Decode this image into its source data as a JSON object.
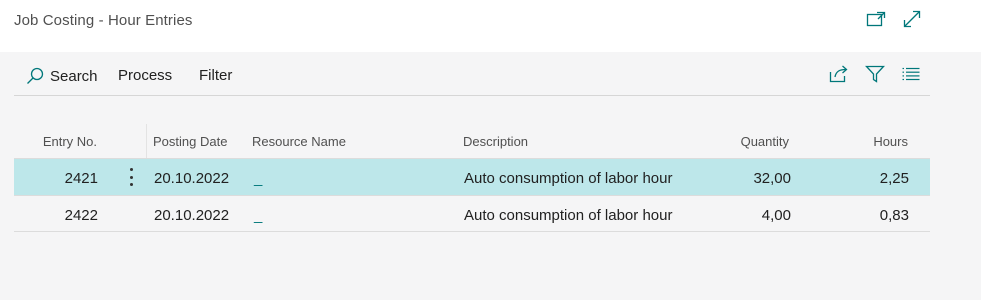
{
  "page": {
    "title": "Job Costing - Hour Entries"
  },
  "toolbar": {
    "search_label": "Search",
    "process_label": "Process",
    "filter_label": "Filter"
  },
  "columns": {
    "entry_no": "Entry No.",
    "posting_date": "Posting Date",
    "resource_name": "Resource Name",
    "description": "Description",
    "quantity": "Quantity",
    "hours": "Hours"
  },
  "rows": [
    {
      "entry_no": "2421",
      "posting_date": "20.10.2022",
      "resource_name": "_",
      "description": "Auto consumption of labor hour",
      "quantity": "32,00",
      "hours": "2,25",
      "selected": true
    },
    {
      "entry_no": "2422",
      "posting_date": "20.10.2022",
      "resource_name": "_",
      "description": "Auto consumption of labor hour",
      "quantity": "4,00",
      "hours": "0,83",
      "selected": false
    }
  ],
  "icons": {
    "popout": "popout-icon",
    "expand": "expand-icon",
    "search": "search-icon",
    "share": "share-icon",
    "filter": "filter-icon",
    "list": "list-icon"
  },
  "colors": {
    "accent": "#00777a",
    "selected_row": "#bde7ea",
    "background": "#f5f5f6"
  }
}
